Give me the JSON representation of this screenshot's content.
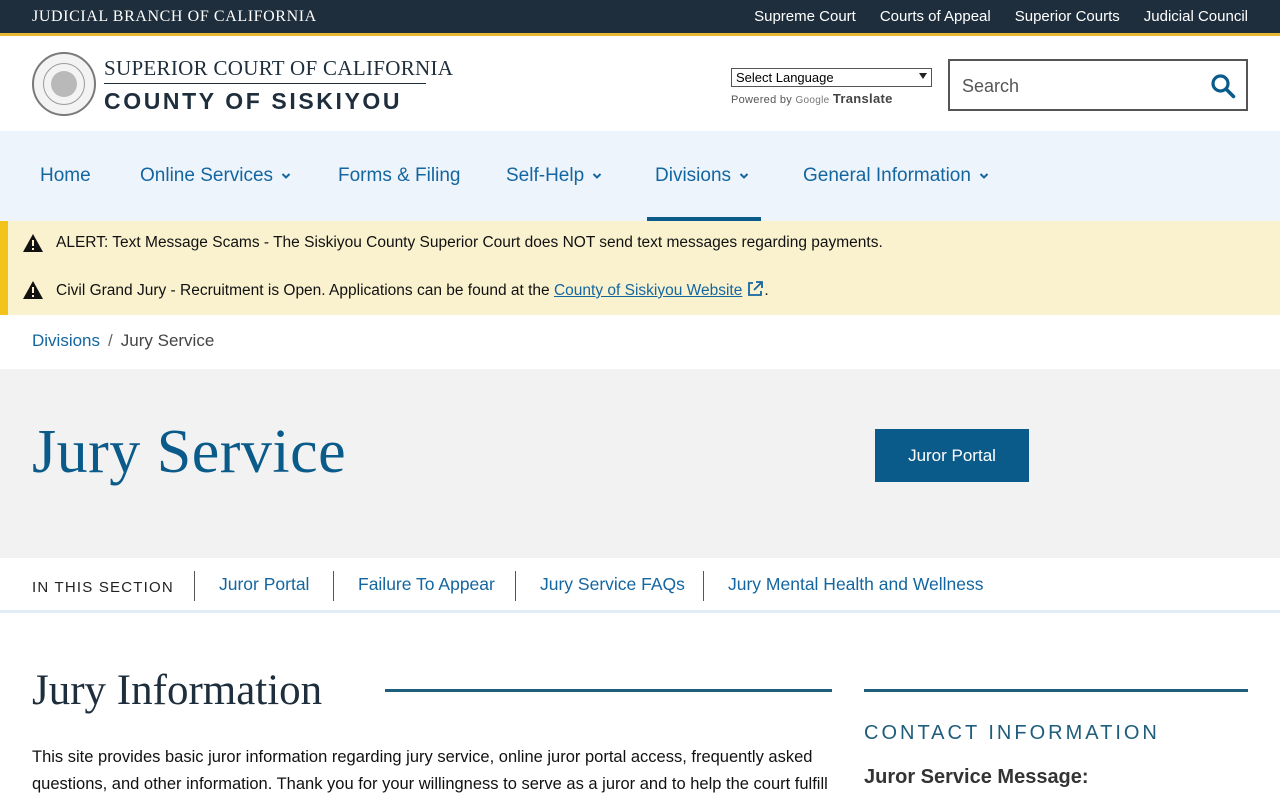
{
  "topbar": {
    "brand": "JUDICIAL BRANCH OF CALIFORNIA",
    "links": [
      "Supreme Court",
      "Courts of Appeal",
      "Superior Courts",
      "Judicial Council"
    ]
  },
  "header": {
    "line1": "SUPERIOR COURT OF CALIFORNIA",
    "line2": "COUNTY OF SISKIYOU",
    "language_select": "Select Language",
    "powered_by": "Powered by",
    "google": "Google",
    "translate": "Translate",
    "search_placeholder": "Search"
  },
  "nav": {
    "items": [
      {
        "label": "Home"
      },
      {
        "label": "Online Services"
      },
      {
        "label": "Forms & Filing"
      },
      {
        "label": "Self-Help"
      },
      {
        "label": "Divisions"
      },
      {
        "label": "General Information"
      }
    ]
  },
  "alerts": {
    "a1": "ALERT: Text Message Scams - The Siskiyou County Superior Court does NOT send text messages regarding payments.",
    "a2_text": "Civil Grand Jury - Recruitment is Open.  Applications can be found at the ",
    "a2_link": "County of Siskiyou Website",
    "a2_end": "."
  },
  "breadcrumb": {
    "parent": "Divisions",
    "sep": "/",
    "current": "Jury Service"
  },
  "hero": {
    "title": "Jury Service",
    "button": "Juror Portal"
  },
  "section_nav": {
    "label": "IN THIS SECTION",
    "links": [
      "Juror Portal",
      "Failure To Appear",
      "Jury Service FAQs",
      "Jury Mental Health and Wellness"
    ]
  },
  "content": {
    "heading": "Jury Information",
    "body": "This site provides basic juror information regarding jury service, online juror portal access, frequently asked questions, and other information.  Thank you for your willingness to serve as a juror and to help the court fulfill"
  },
  "aside": {
    "title": "CONTACT INFORMATION",
    "subtitle": "Juror Service Message:"
  },
  "colors": {
    "topbar": "#1e2e3c",
    "accent_gold": "#e8b830",
    "link_blue": "#1466a0",
    "primary": "#0b5b8a",
    "alert_bg": "#faf2cf"
  }
}
